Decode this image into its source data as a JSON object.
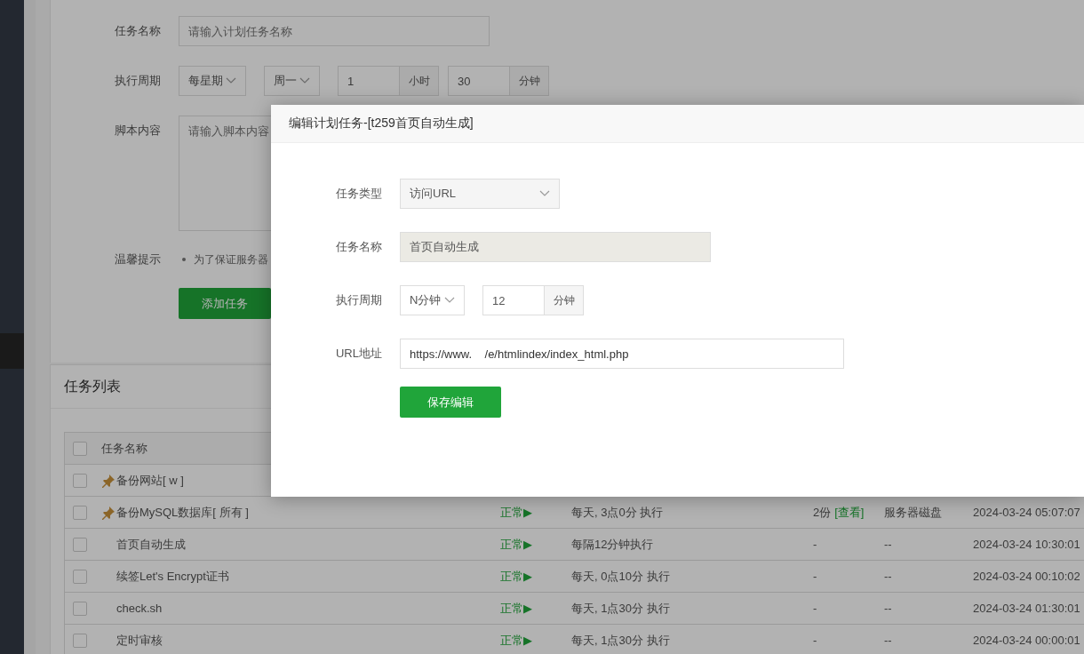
{
  "task_form": {
    "name_label": "任务名称",
    "name_placeholder": "请输入计划任务名称",
    "period_label": "执行周期",
    "period_type": "每星期",
    "weekday": "周一",
    "hour": "1",
    "hour_unit": "小时",
    "minute": "30",
    "minute_unit": "分钟",
    "script_label": "脚本内容",
    "script_placeholder": "请输入脚本内容",
    "tip_label": "温馨提示",
    "tips": [
      "为了保证服务器"
    ],
    "submit": "添加任务"
  },
  "task_list": {
    "title": "任务列表",
    "columns": [
      "任务名称"
    ],
    "all_checked": false,
    "rows": [
      {
        "name": "备份网站[ w ]",
        "pinned": true,
        "checked": false
      },
      {
        "name": "备份MySQL数据库[ 所有 ]",
        "pinned": true,
        "checked": false,
        "status": "正常▶",
        "schedule": "每天, 3点0分 执行",
        "backup": "2份",
        "backup_link": "[查看]",
        "location": "服务器磁盘",
        "time": "2024-03-24 05:07:07"
      },
      {
        "name": "首页自动生成",
        "pinned": false,
        "checked": false,
        "status": "正常▶",
        "schedule": "每隔12分钟执行",
        "backup": "-",
        "location": "--",
        "time": "2024-03-24 10:30:01"
      },
      {
        "name": "续签Let's Encrypt证书",
        "pinned": false,
        "checked": false,
        "status": "正常▶",
        "schedule": "每天, 0点10分 执行",
        "backup": "-",
        "location": "--",
        "time": "2024-03-24 00:10:02"
      },
      {
        "name": "check.sh",
        "pinned": false,
        "checked": false,
        "status": "正常▶",
        "schedule": "每天, 1点30分 执行",
        "backup": "-",
        "location": "--",
        "time": "2024-03-24 01:30:01"
      },
      {
        "name": "定时审核",
        "pinned": false,
        "checked": false,
        "status": "正常▶",
        "schedule": "每天, 1点30分 执行",
        "backup": "-",
        "location": "--",
        "time": "2024-03-24 00:00:01"
      }
    ]
  },
  "dialog": {
    "title": "编辑计划任务-[t259首页自动生成]",
    "type_label": "任务类型",
    "type_value": "访问URL",
    "name_label": "任务名称",
    "name_value": "首页自动生成",
    "period_label": "执行周期",
    "period_type": "N分钟",
    "minutes": "12",
    "minutes_unit": "分钟",
    "url_label": "URL地址",
    "url_value": "https://www.    /e/htmlindex/index_html.php",
    "save": "保存编辑"
  }
}
